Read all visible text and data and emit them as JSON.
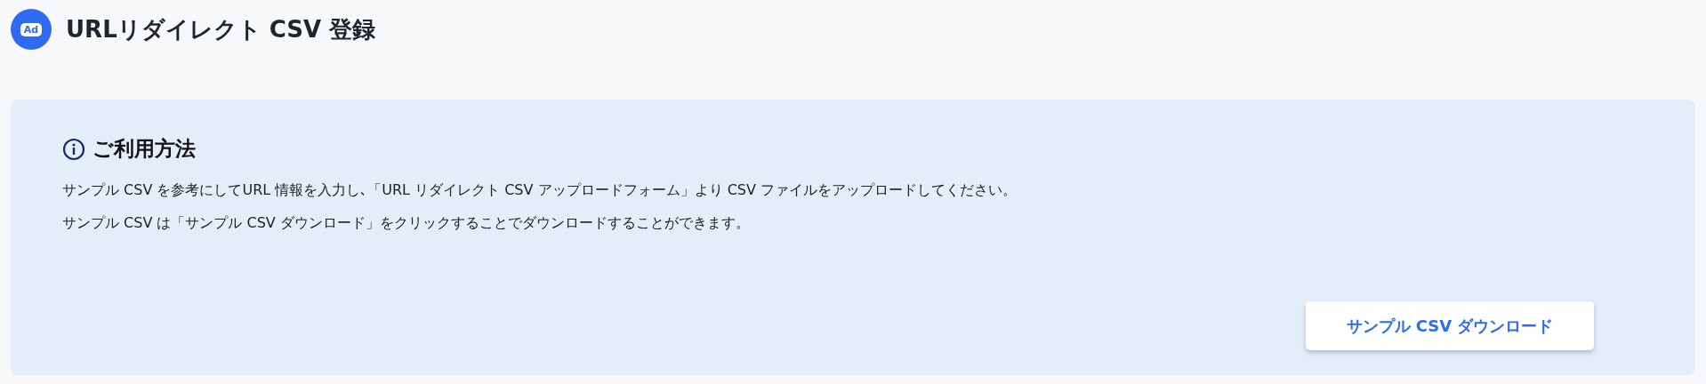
{
  "header": {
    "logo_text": "Ad",
    "title": "URLリダイレクト CSV 登録"
  },
  "usage_panel": {
    "heading": "ご利用方法",
    "lines": [
      "サンプル CSV を参考にしてURL 情報を入力し､「URL リダイレクト CSV アップロードフォーム」より CSV ファイルをアップロードしてください。",
      "サンプル CSV は「サンプル CSV ダウンロード」をクリックすることでダウンロードすることができます。"
    ],
    "button": "サンプル CSV ダウンロード"
  }
}
